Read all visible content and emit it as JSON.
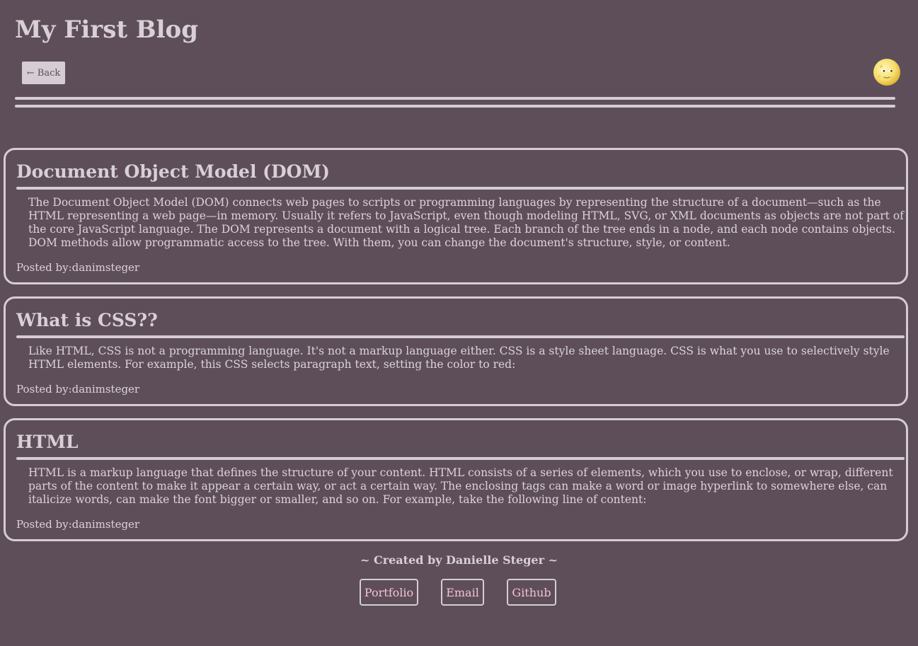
{
  "header": {
    "title": "My First Blog",
    "back_label": "← Back",
    "theme_icon": "moon-icon"
  },
  "posts": [
    {
      "title": "Document Object Model (DOM)",
      "body": "The Document Object Model (DOM) connects web pages to scripts or programming languages by representing the structure of a document—such as the HTML representing a web page—in memory. Usually it refers to JavaScript, even though modeling HTML, SVG, or XML documents as objects are not part of the core JavaScript language. The DOM represents a document with a logical tree. Each branch of the tree ends in a node, and each node contains objects. DOM methods allow programmatic access to the tree. With them, you can change the document's structure, style, or content.",
      "author": "Posted by:danimsteger"
    },
    {
      "title": "What is CSS??",
      "body": "Like HTML, CSS is not a programming language. It's not a markup language either. CSS is a style sheet language. CSS is what you use to selectively style HTML elements. For example, this CSS selects paragraph text, setting the color to red:",
      "author": "Posted by:danimsteger"
    },
    {
      "title": "HTML",
      "body": "HTML is a markup language that defines the structure of your content. HTML consists of a series of elements, which you use to enclose, or wrap, different parts of the content to make it appear a certain way, or act a certain way. The enclosing tags can make a word or image hyperlink to somewhere else, can italicize words, can make the font bigger or smaller, and so on. For example, take the following line of content:",
      "author": "Posted by:danimsteger"
    }
  ],
  "footer": {
    "credit": "~ Created by Danielle Steger ~",
    "links": [
      "Portfolio",
      "Email",
      "Github"
    ]
  },
  "colors": {
    "background": "#5e4e5a",
    "text": "#dcd3d9",
    "border": "#d5cdd3",
    "link": "#f0c4cf"
  }
}
